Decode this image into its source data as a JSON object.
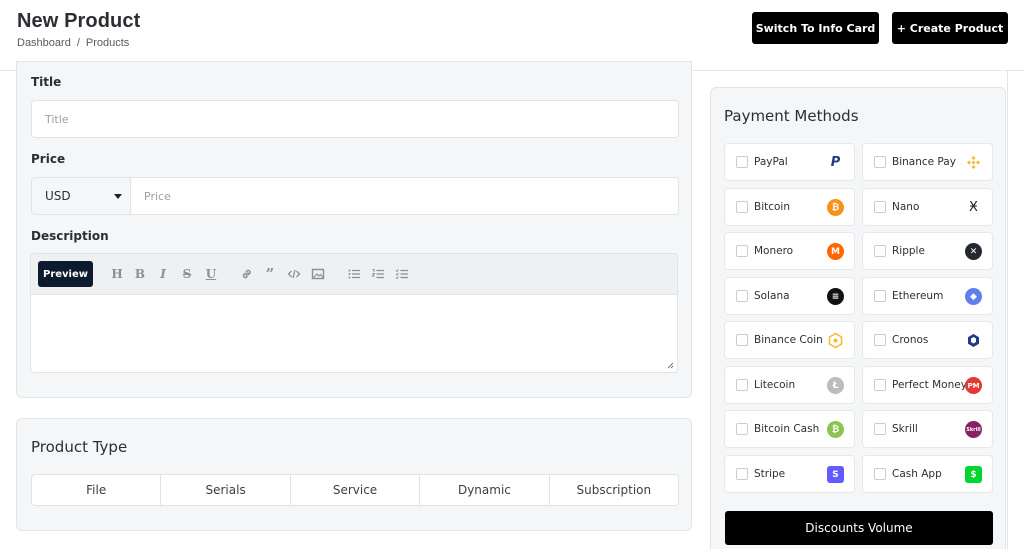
{
  "header": {
    "title": "New Product",
    "breadcrumb": [
      "Dashboard",
      "Products"
    ],
    "breadcrumb_sep": "/",
    "switch_label": "Switch To Info Card",
    "create_label": "+ Create Product"
  },
  "form": {
    "title_label": "Title",
    "title_placeholder": "Title",
    "price_label": "Price",
    "currency": "USD",
    "price_placeholder": "Price",
    "description_label": "Description",
    "preview_label": "Preview",
    "toolbar_icons": [
      "heading-icon",
      "bold-icon",
      "italic-icon",
      "strikethrough-icon",
      "underline-icon",
      "link-icon",
      "quote-icon",
      "code-icon",
      "image-icon",
      "bullet-list-icon",
      "numbered-list-icon",
      "task-list-icon"
    ]
  },
  "product_type": {
    "title": "Product Type",
    "tabs": [
      "File",
      "Serials",
      "Service",
      "Dynamic",
      "Subscription"
    ]
  },
  "payment": {
    "title": "Payment Methods",
    "methods": [
      {
        "name": "PayPal",
        "icon": "paypal-icon",
        "color": "#253b80"
      },
      {
        "name": "Binance Pay",
        "icon": "binance-pay-icon",
        "color": "#f3ba2f"
      },
      {
        "name": "Bitcoin",
        "icon": "bitcoin-icon",
        "color": "#f7931a"
      },
      {
        "name": "Nano",
        "icon": "nano-icon",
        "color": "#222222"
      },
      {
        "name": "Monero",
        "icon": "monero-icon",
        "color": "#ff6600"
      },
      {
        "name": "Ripple",
        "icon": "ripple-icon",
        "color": "#23292f"
      },
      {
        "name": "Solana",
        "icon": "solana-icon",
        "color": "#111111"
      },
      {
        "name": "Ethereum",
        "icon": "ethereum-icon",
        "color": "#627eea"
      },
      {
        "name": "Binance Coin",
        "icon": "binance-coin-icon",
        "color": "#f3ba2f"
      },
      {
        "name": "Cronos",
        "icon": "cronos-icon",
        "color": "#1e3a8a"
      },
      {
        "name": "Litecoin",
        "icon": "litecoin-icon",
        "color": "#bfbbbb"
      },
      {
        "name": "Perfect Money",
        "icon": "perfect-money-icon",
        "color": "#e53935"
      },
      {
        "name": "Bitcoin Cash",
        "icon": "bitcoin-cash-icon",
        "color": "#8dc351"
      },
      {
        "name": "Skrill",
        "icon": "skrill-icon",
        "color": "#862165"
      },
      {
        "name": "Stripe",
        "icon": "stripe-icon",
        "color": "#635bff"
      },
      {
        "name": "Cash App",
        "icon": "cash-app-icon",
        "color": "#00d632"
      }
    ],
    "discount_label": "Discounts Volume"
  }
}
